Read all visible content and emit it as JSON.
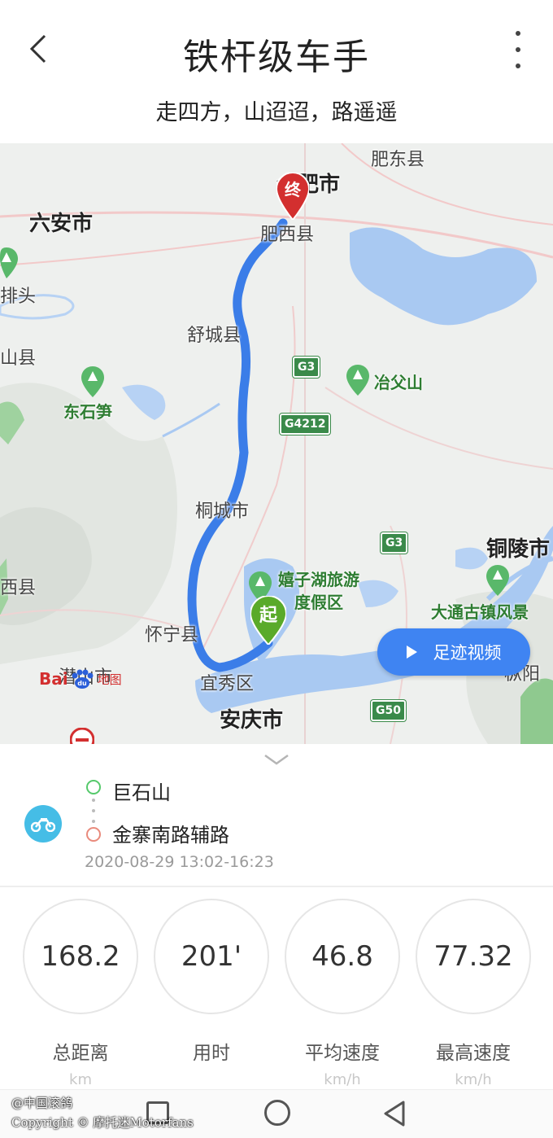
{
  "header": {
    "title": "铁杆级车手",
    "subtitle": "走四方，山迢迢，路遥遥"
  },
  "map": {
    "cities": [
      "合肥市",
      "六安市",
      "铜陵市",
      "安庆市"
    ],
    "counties": [
      "肥东县",
      "肥西县",
      "舒城县",
      "桐城市",
      "怀宁县",
      "潜山市",
      "宜秀区",
      "排头",
      "山县",
      "西县",
      "枞阳"
    ],
    "pois": [
      "冶父山",
      "东石笋",
      "嬉子湖旅游",
      "度假区",
      "大通古镇风景"
    ],
    "highways": [
      "G3",
      "G4212",
      "G3",
      "G50"
    ],
    "markers": {
      "end": "终",
      "start": "起"
    },
    "footprint_video_label": "足迹视频",
    "baidu_logo": {
      "text": "Bai",
      "du": "du",
      "sub": "地图"
    },
    "colors": {
      "route": "#3b7de8",
      "water": "#a9c9f2",
      "marker_end": "#d32f2f",
      "marker_start": "#5aaa2a"
    }
  },
  "trip": {
    "start": "巨石山",
    "end": "金寨南路辅路",
    "time_range": "2020-08-29 13:02-16:23"
  },
  "stats": [
    {
      "value": "168.2",
      "label": "总距离",
      "unit": "km"
    },
    {
      "value": "201'",
      "label": "用时",
      "unit": ""
    },
    {
      "value": "46.8",
      "label": "平均速度",
      "unit": "km/h"
    },
    {
      "value": "77.32",
      "label": "最高速度",
      "unit": "km/h"
    }
  ],
  "watermark": {
    "line1": "@中国滚鸽",
    "line2": "Copyright © 摩托迷Motorfans"
  }
}
